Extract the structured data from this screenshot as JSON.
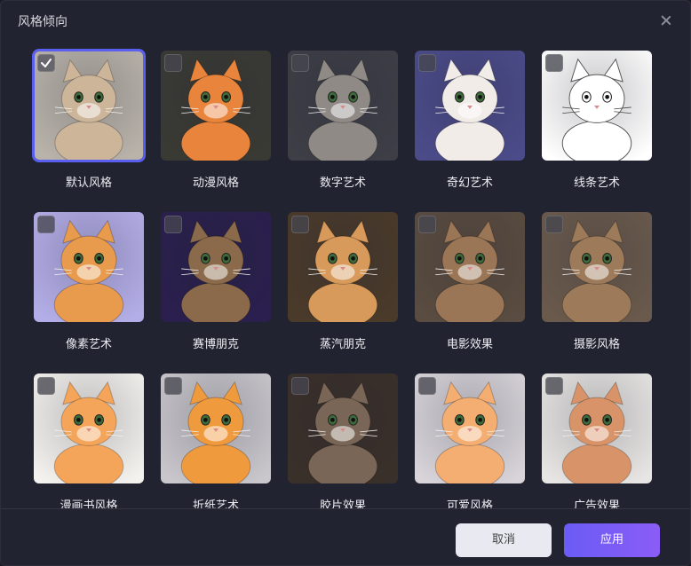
{
  "dialog": {
    "title": "风格倾向",
    "close_icon": "close-icon"
  },
  "styles": [
    {
      "label": "默认风格",
      "selected": true,
      "bg": "#b9b3aa",
      "cat": "#cdb59a"
    },
    {
      "label": "动漫风格",
      "selected": false,
      "bg": "#3a3a34",
      "cat": "#e8843c"
    },
    {
      "label": "数字艺术",
      "selected": false,
      "bg": "#3d3e46",
      "cat": "#8f8a86"
    },
    {
      "label": "奇幻艺术",
      "selected": false,
      "bg": "#4b4b8a",
      "cat": "#f1ece8"
    },
    {
      "label": "线条艺术",
      "selected": false,
      "bg": "#ffffff",
      "cat": "#ffffff"
    },
    {
      "label": "像素艺术",
      "selected": false,
      "bg": "#b4aee8",
      "cat": "#e89b4c"
    },
    {
      "label": "赛博朋克",
      "selected": false,
      "bg": "#2a1f4e",
      "cat": "#8a6a4a"
    },
    {
      "label": "蒸汽朋克",
      "selected": false,
      "bg": "#4a3a2a",
      "cat": "#d89a5a"
    },
    {
      "label": "电影效果",
      "selected": false,
      "bg": "#5a4c40",
      "cat": "#9a7656"
    },
    {
      "label": "摄影风格",
      "selected": false,
      "bg": "#6a5a4c",
      "cat": "#9c7a5a"
    },
    {
      "label": "漫画书风格",
      "selected": false,
      "bg": "#f4f2ee",
      "cat": "#f5a55a"
    },
    {
      "label": "折纸艺术",
      "selected": false,
      "bg": "#c9c7cc",
      "cat": "#f09a3e"
    },
    {
      "label": "胶片效果",
      "selected": false,
      "bg": "#3a302a",
      "cat": "#7a6656"
    },
    {
      "label": "可爱风格",
      "selected": false,
      "bg": "#d8d4da",
      "cat": "#f4ae72"
    },
    {
      "label": "广告效果",
      "selected": false,
      "bg": "#e8e6e4",
      "cat": "#d89468"
    }
  ],
  "footer": {
    "cancel_label": "取消",
    "apply_label": "应用"
  },
  "colors": {
    "accent": "#5a5ff0",
    "apply_gradient_start": "#6a5cf5",
    "apply_gradient_end": "#8b5cf6"
  }
}
